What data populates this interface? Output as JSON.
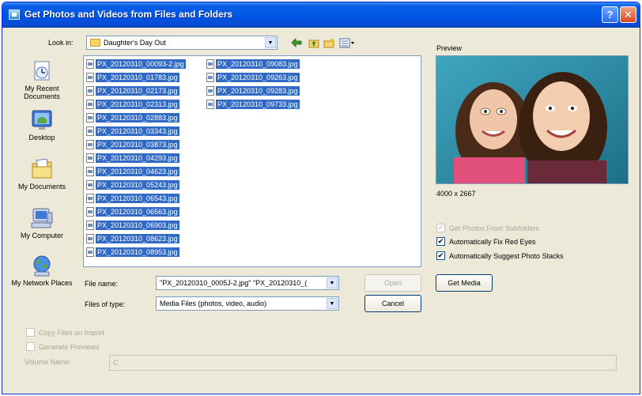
{
  "window": {
    "title": "Get Photos and Videos from Files and Folders",
    "help_glyph": "?",
    "close_glyph": "✕"
  },
  "look_in": {
    "label": "Look in:",
    "value": "Daughter's Day Out"
  },
  "toolbar": {
    "back_icon": "back-arrow-icon",
    "up_icon": "up-folder-icon",
    "new_folder_icon": "new-folder-icon",
    "views_icon": "views-menu-icon"
  },
  "places": [
    {
      "label": "My Recent Documents",
      "icon": "recent-documents-icon"
    },
    {
      "label": "Desktop",
      "icon": "desktop-icon"
    },
    {
      "label": "My Documents",
      "icon": "my-documents-icon"
    },
    {
      "label": "My Computer",
      "icon": "my-computer-icon"
    },
    {
      "label": "My Network Places",
      "icon": "network-places-icon"
    }
  ],
  "files": {
    "col1": [
      "PX_20120310_00093-2.jpg",
      "PX_20120310_01783.jpg",
      "PX_20120310_02173.jpg",
      "PX_20120310_02313.jpg",
      "PX_20120310_02883.jpg",
      "PX_20120310_03343.jpg",
      "PX_20120310_03873.jpg",
      "PX_20120310_04293.jpg",
      "PX_20120310_04623.jpg",
      "PX_20120310_05243.jpg",
      "PX_20120310_06543.jpg",
      "PX_20120310_06563.jpg",
      "PX_20120310_06903.jpg",
      "PX_20120310_08623.jpg",
      "PX_20120310_08953.jpg"
    ],
    "col2": [
      "PX_20120310_09083.jpg",
      "PX_20120310_09263.jpg",
      "PX_20120310_09283.jpg",
      "PX_20120310_09733.jpg"
    ]
  },
  "file_name": {
    "label": "File name:",
    "value": "\"PX_20120310_0005J-2.jpg\" \"PX_20120310_("
  },
  "file_type": {
    "label": "Files of type:",
    "value": "Media Files (photos, video, audio)"
  },
  "buttons": {
    "open": "Open",
    "cancel": "Cancel",
    "get_media": "Get Media"
  },
  "preview": {
    "label": "Preview",
    "dimensions": "4000 x 2667"
  },
  "options": {
    "get_photos_subfolders": {
      "label": "Get Photos From Subfolders",
      "checked": true,
      "enabled": false
    },
    "fix_red_eyes": {
      "label": "Automatically Fix Red Eyes",
      "checked": true,
      "enabled": true
    },
    "suggest_stacks": {
      "label": "Automatically Suggest Photo Stacks",
      "checked": true,
      "enabled": true
    },
    "copy_files_on_import": {
      "label": "Copy Files on Import",
      "checked": false,
      "enabled": false
    },
    "generate_previews": {
      "label": "Generate Previews",
      "checked": false,
      "enabled": false
    }
  },
  "volume_name": {
    "label": "Volume Name:",
    "value": "C"
  },
  "check_glyph": "✔"
}
